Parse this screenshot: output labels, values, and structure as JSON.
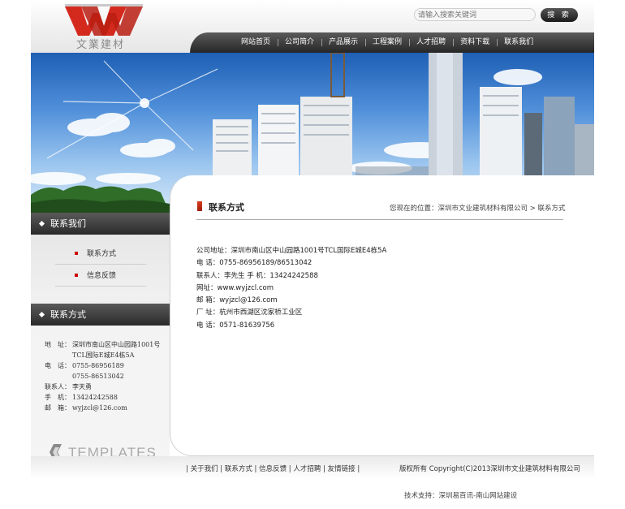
{
  "header": {
    "logo_text": "文業建材",
    "search_placeholder": "请输入搜索关键词",
    "search_button": "搜 索"
  },
  "nav": {
    "items": [
      "网站首页",
      "公司简介",
      "产品展示",
      "工程案例",
      "人才招聘",
      "资料下载",
      "联系我们"
    ]
  },
  "sidebar": {
    "contact_us_title": "联系我们",
    "sub_items": [
      "联系方式",
      "信息反馈"
    ],
    "contact_title": "联系方式",
    "contact": [
      {
        "k": "地　址：",
        "v": "深圳市南山区中山园路1001号"
      },
      {
        "k": "",
        "v": "TCL国际E城E4栋5A"
      },
      {
        "k": "电　话：",
        "v": "0755-86956189"
      },
      {
        "k": "",
        "v": "0755-86513042"
      },
      {
        "k": "联系人：",
        "v": "李天勇"
      },
      {
        "k": "手　机：",
        "v": "13424242588"
      },
      {
        "k": "邮　箱：",
        "v": "wyjzcl@126.com"
      }
    ],
    "templates_text": "TEMPLATES"
  },
  "main": {
    "title": "联系方式",
    "breadcrumb": "您现在的位置：深圳市文业建筑材料有限公司 > 联系方式",
    "info": [
      "公司地址：深圳市南山区中山园路1001号TCL国际E城E4栋5A",
      "电 话：0755-86956189/86513042",
      "联系人：李先生     手 机：13424242588",
      "网址：www.wyjzcl.com",
      "邮 箱：wyjzcl@126.com",
      "厂 址：杭州市西湖区沈家桥工业区",
      "电 话：0571-81639756"
    ]
  },
  "footer": {
    "links": "|  关于我们  |  联系方式  |  信息反馈  |  人才招聘  |  友情链接  |",
    "copyright": "版权所有 Copyright(C)2013深圳市文业建筑材料有限公司",
    "support": "技术支持：深圳易百讯-南山网站建设"
  },
  "colors": {
    "nav_bg": "#2f2f2f",
    "bullet": "#cc0000",
    "logo_red": "#d42a1e"
  }
}
